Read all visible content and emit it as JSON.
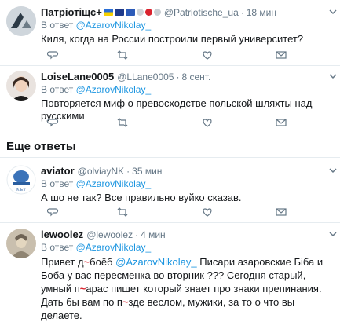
{
  "tweets": [
    {
      "name": "Патріотiщє+",
      "handle": "@Patriotische_ua",
      "time": "18 мин",
      "reply_prefix": "В ответ",
      "reply_to": "@AzarovNikolay_",
      "text": "Киля, когда на России построили первый университет?"
    },
    {
      "name": "LoiseLane0005",
      "handle": "@LLane0005",
      "time": "8 сент.",
      "reply_prefix": "В ответ",
      "reply_to": "@AzarovNikolay_",
      "text": "Повторяется миф о превосходстве польской шляхты над русскими"
    },
    {
      "name": "aviator",
      "handle": "@olviayNK",
      "time": "35 мин",
      "reply_prefix": "В ответ",
      "reply_to": "@AzarovNikolay_",
      "text": "А шо не так? Все правильно вуйко сказав."
    },
    {
      "name": "lewoolez",
      "handle": "@lewoolez",
      "time": "4 мин",
      "reply_prefix": "В ответ",
      "reply_to": "@AzarovNikolay_",
      "text_parts": {
        "p1": "Привет д",
        "p1b": "боёб",
        "mention": "@AzarovNikolay_",
        "p2": " Писари азаровские Біба и Боба у вас пересменка во вторник ??? Сегодня старый, умный п",
        "p2b": "арас пишет который знает про знаки препинания. Дать бы вам по п",
        "p3": "зде веслом, мужики, за то о что вы делаете."
      }
    }
  ],
  "section_title": "Еще ответы",
  "colors": {
    "accent": "#1b95e0",
    "muted": "#657786",
    "text": "#14171a",
    "divider": "#e6ecf0"
  },
  "icons": [
    "chevron-down-icon",
    "reply-icon",
    "retweet-icon",
    "like-icon",
    "message-icon"
  ]
}
